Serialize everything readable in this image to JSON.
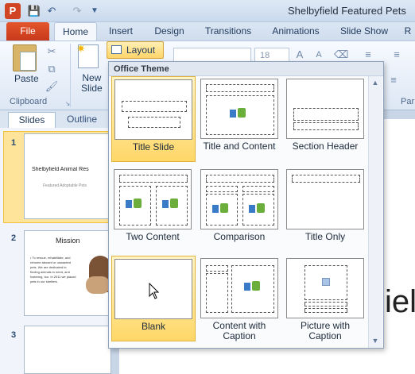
{
  "window": {
    "title": "Shelbyfield Featured Pets"
  },
  "quick_access": {
    "app_logo": "P",
    "save_icon": "save-icon",
    "undo_icon": "undo-icon",
    "redo_icon": "redo-icon"
  },
  "tabs": [
    {
      "label": "File"
    },
    {
      "label": "Home"
    },
    {
      "label": "Insert"
    },
    {
      "label": "Design"
    },
    {
      "label": "Transitions"
    },
    {
      "label": "Animations"
    },
    {
      "label": "Slide Show"
    },
    {
      "label": "R"
    }
  ],
  "ribbon": {
    "paste_label": "Paste",
    "new_slide_label": "New\nSlide",
    "layout_label": "Layout",
    "font_size": "18",
    "clipboard_group": "Clipboard",
    "para_group": "Par"
  },
  "slide_pane": {
    "tab_slides": "Slides",
    "tab_outline": "Outline",
    "slides": [
      {
        "number": "1",
        "title": "Shelbyfield Animal Res",
        "subtitle": "Featured Adoptable Pets"
      },
      {
        "number": "2",
        "title": "Mission",
        "bullets": "• To rescue, rehabilitate, and rehome abused or unwanted pets. We are dedicated to finding animals in need, and fostering, too. In 2011 we placed pets in our shelters."
      },
      {
        "number": "3"
      }
    ]
  },
  "main": {
    "big_text": "iel"
  },
  "layout_menu": {
    "header": "Office Theme",
    "layouts": [
      {
        "label": "Title Slide",
        "selected": true
      },
      {
        "label": "Title and Content",
        "selected": false
      },
      {
        "label": "Section Header",
        "selected": false
      },
      {
        "label": "Two Content",
        "selected": false
      },
      {
        "label": "Comparison",
        "selected": false
      },
      {
        "label": "Title Only",
        "selected": false
      },
      {
        "label": "Blank",
        "selected": true
      },
      {
        "label": "Content with Caption",
        "selected": false
      },
      {
        "label": "Picture with Caption",
        "selected": false
      }
    ]
  },
  "colors": {
    "accent_file": "#d04423",
    "selected_cell": "#ffd768",
    "ribbon": "#dde7f4"
  }
}
